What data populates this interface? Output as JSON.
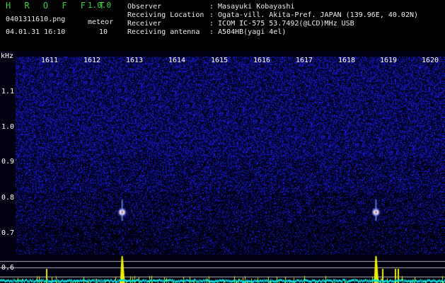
{
  "header": {
    "app_name": "H R O F F T",
    "version": "1.0.0",
    "filename": "0401311610.png",
    "datetime": "04.01.31 16:10",
    "meteor_label": "meteor",
    "meteor_count": "10"
  },
  "info": [
    {
      "key": "Observer",
      "value": ": Masayuki Kobayashi"
    },
    {
      "key": "Receiving Location",
      "value": ": Ogata-vill. Akita-Pref. JAPAN (139.96E, 40.02N)"
    },
    {
      "key": "Receiver",
      "value": ": ICOM IC-575 53.7492(@LCD)MHz USB"
    },
    {
      "key": "Receiving antenna",
      "value": ": A504HB(yagi 4el)"
    }
  ],
  "axis": {
    "khz_label": "kHz",
    "time_ticks": [
      "1611",
      "1612",
      "1613",
      "1614",
      "1615",
      "1616",
      "1617",
      "1618",
      "1619",
      "1620"
    ],
    "freq_ticks": [
      "1.1",
      "1.0",
      "0.9",
      "0.8",
      "0.7",
      "0.6"
    ]
  },
  "colors": {
    "background": "#000010",
    "noise": "#2020c0",
    "title_green": "#36d13a",
    "signal_yellow": "#f0f000",
    "baseline_cyan": "#00e0e0"
  },
  "meteor_times": [
    1612.75,
    1618.75
  ]
}
